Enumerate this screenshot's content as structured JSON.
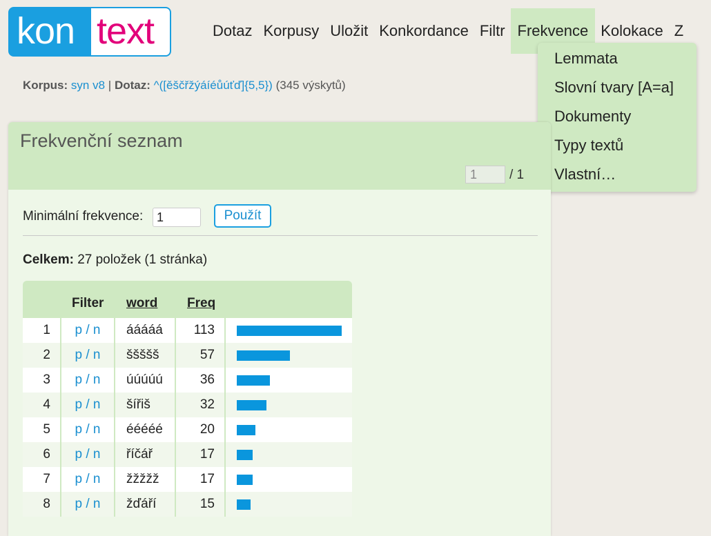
{
  "logo": {
    "part1": "kon",
    "part2": "text"
  },
  "nav": [
    "Dotaz",
    "Korpusy",
    "Uložit",
    "Konkordance",
    "Filtr",
    "Frekvence",
    "Kolokace",
    "Z"
  ],
  "dropdown": [
    "Lemmata",
    "Slovní tvary [A=a]",
    "Dokumenty",
    "Typy textů",
    "Vlastní…"
  ],
  "breadcrumb": {
    "corpus_label": "Korpus:",
    "corpus_value": "syn v8",
    "separator": "|",
    "query_label": "Dotaz:",
    "query_value": "^([ěščřžýáíéůúťď]{5,5})",
    "hits": "(345 výskytů)"
  },
  "panel": {
    "title": "Frekvenční seznam",
    "page_current": "1",
    "page_total": "/ 1",
    "min_freq_label": "Minimální frekvence:",
    "min_freq_value": "1",
    "apply_label": "Použít",
    "summary_bold": "Celkem:",
    "summary_text": "27 položek (1 stránka)"
  },
  "table": {
    "headers": {
      "filter": "Filter",
      "word": "word",
      "freq": "Freq"
    },
    "rows": [
      {
        "num": "1",
        "filter": "p / n",
        "word": "ááááá",
        "freq": "113",
        "ratio": 1.0
      },
      {
        "num": "2",
        "filter": "p / n",
        "word": "ššššš",
        "freq": "57",
        "ratio": 0.504
      },
      {
        "num": "3",
        "filter": "p / n",
        "word": "úúúúú",
        "freq": "36",
        "ratio": 0.319
      },
      {
        "num": "4",
        "filter": "p / n",
        "word": "šířiš",
        "freq": "32",
        "ratio": 0.283
      },
      {
        "num": "5",
        "filter": "p / n",
        "word": "ééééé",
        "freq": "20",
        "ratio": 0.177
      },
      {
        "num": "6",
        "filter": "p / n",
        "word": "říčář",
        "freq": "17",
        "ratio": 0.15
      },
      {
        "num": "7",
        "filter": "p / n",
        "word": "žžžžž",
        "freq": "17",
        "ratio": 0.15
      },
      {
        "num": "8",
        "filter": "p / n",
        "word": "žďáří",
        "freq": "15",
        "ratio": 0.133
      }
    ]
  },
  "colors": {
    "accent": "#1a9fe0",
    "brand_pink": "#e2007a",
    "panel_green": "#cfe9c2",
    "bar": "#0a96dd"
  }
}
